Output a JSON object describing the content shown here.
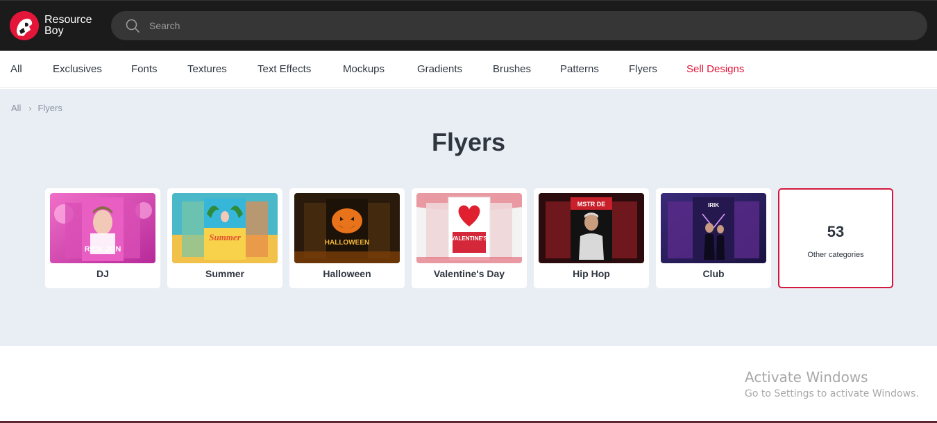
{
  "header": {
    "logo_line1": "Resource",
    "logo_line2": "Boy",
    "search_placeholder": "Search"
  },
  "nav": {
    "items": [
      "All",
      "Exclusives",
      "Fonts",
      "Textures",
      "Text Effects",
      "Mockups",
      "Gradients",
      "Brushes",
      "Patterns",
      "Flyers",
      "Sell Designs"
    ],
    "accent_color": "#e3163a"
  },
  "breadcrumb": {
    "root": "All",
    "current": "Flyers"
  },
  "page": {
    "title": "Flyers"
  },
  "categories": [
    {
      "label": "DJ",
      "thumb_text": "RICK JON"
    },
    {
      "label": "Summer",
      "thumb_text": "Summer"
    },
    {
      "label": "Halloween",
      "thumb_text": "HALLOWEEN"
    },
    {
      "label": "Valentine's Day",
      "thumb_text": "VALENTINE'S"
    },
    {
      "label": "Hip Hop",
      "thumb_text": "MSTR DE"
    },
    {
      "label": "Club",
      "thumb_text": "IRIK"
    }
  ],
  "more_categories": {
    "count": "53",
    "label": "Other categories"
  },
  "watermark": {
    "title": "Activate Windows",
    "subtitle": "Go to Settings to activate Windows."
  },
  "icons": {
    "logo": "resource-boy-logo-icon",
    "search": "search-icon"
  }
}
